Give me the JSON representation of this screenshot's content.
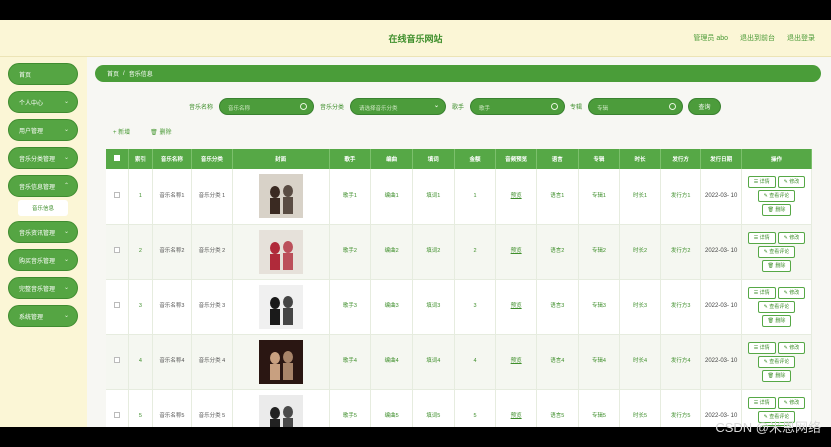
{
  "header": {
    "title": "在线音乐网站",
    "admin_label": "管理员 abo",
    "exit_backend": "退出到前台",
    "logout": "退出登录"
  },
  "sidebar": {
    "items": [
      {
        "label": "首页"
      },
      {
        "label": "个人中心"
      },
      {
        "label": "用户管理"
      },
      {
        "label": "音乐分类管理"
      },
      {
        "label": "音乐信息管理"
      },
      {
        "label": "音乐资讯管理"
      },
      {
        "label": "购买音乐管理"
      },
      {
        "label": "完整音乐管理"
      },
      {
        "label": "系统管理"
      }
    ],
    "sub_item": "音乐信息"
  },
  "breadcrumb": {
    "home": "首页",
    "sep": "/",
    "current": "音乐信息"
  },
  "search": {
    "name_label": "音乐名称",
    "name_placeholder": "音乐名称",
    "category_label": "音乐分类",
    "category_placeholder": "请选择音乐分类",
    "singer_label": "歌手",
    "singer_placeholder": "歌手",
    "album_label": "专辑",
    "album_placeholder": "专辑",
    "button": "查询"
  },
  "actions": {
    "add": "+ 新增",
    "delete": "删除"
  },
  "table": {
    "headers": [
      "索引",
      "音乐名称",
      "音乐分类",
      "封面",
      "歌手",
      "编曲",
      "填词",
      "金额",
      "音频预览",
      "语言",
      "专辑",
      "时长",
      "发行方",
      "发行日期",
      "操作"
    ],
    "rows": [
      {
        "index": "1",
        "name": "音乐名称1",
        "category": "音乐分类 1",
        "singer": "歌手1",
        "arranger": "编曲1",
        "lyricist": "填词1",
        "price": "1",
        "preview": "预览",
        "language": "语言1",
        "album": "专辑1",
        "duration": "时长1",
        "publisher": "发行方1",
        "date": "2022-03- 10"
      },
      {
        "index": "2",
        "name": "音乐名称2",
        "category": "音乐分类 2",
        "singer": "歌手2",
        "arranger": "编曲2",
        "lyricist": "填词2",
        "price": "2",
        "preview": "预览",
        "language": "语言2",
        "album": "专辑2",
        "duration": "时长2",
        "publisher": "发行方2",
        "date": "2022-03- 10"
      },
      {
        "index": "3",
        "name": "音乐名称3",
        "category": "音乐分类 3",
        "singer": "歌手3",
        "arranger": "编曲3",
        "lyricist": "填词3",
        "price": "3",
        "preview": "预览",
        "language": "语言3",
        "album": "专辑3",
        "duration": "时长3",
        "publisher": "发行方3",
        "date": "2022-03- 10"
      },
      {
        "index": "4",
        "name": "音乐名称4",
        "category": "音乐分类 4",
        "singer": "歌手4",
        "arranger": "编曲4",
        "lyricist": "填词4",
        "price": "4",
        "preview": "预览",
        "language": "语言4",
        "album": "专辑4",
        "duration": "时长4",
        "publisher": "发行方4",
        "date": "2022-03- 10"
      },
      {
        "index": "5",
        "name": "音乐名称5",
        "category": "音乐分类 5",
        "singer": "歌手5",
        "arranger": "编曲5",
        "lyricist": "填词5",
        "price": "5",
        "preview": "预览",
        "language": "语言5",
        "album": "专辑5",
        "duration": "时长5",
        "publisher": "发行方5",
        "date": "2022-03- 10"
      }
    ],
    "row_buttons": {
      "detail": "详情",
      "edit": "修改",
      "reviews": "查看评论",
      "delete": "删除"
    }
  },
  "watermark": "CSDN @米恩网络",
  "colors": {
    "accent": "#56a846",
    "header_bg": "#fbf6d6",
    "text_green": "#3f8f2c"
  }
}
